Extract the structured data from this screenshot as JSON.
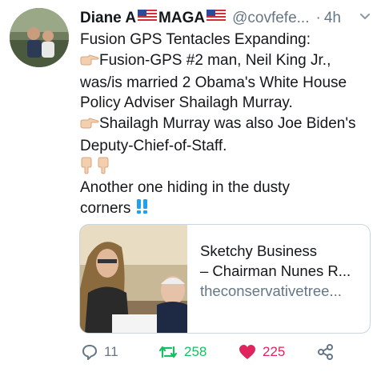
{
  "tweet": {
    "display_name": "Diane A",
    "name_suffix": "MAGA",
    "handle": "@covfefe...",
    "separator": "·",
    "time": "4h",
    "lines": [
      "Fusion GPS Tentacles Expanding:",
      "Fusion-GPS #2 man, Neil King Jr.,",
      "was/is married 2 Obama's White House",
      "Policy Adviser Shailagh Murray.",
      "Shailagh Murray was also Joe Biden's",
      "Deputy-Chief-of-Staff.",
      "Another one hiding in the dusty",
      "corners"
    ]
  },
  "card": {
    "title_line1": "Sketchy Business",
    "title_line2": "– Chairman Nunes R...",
    "domain": "theconservativetree..."
  },
  "actions": {
    "reply_count": "11",
    "retweet_count": "258",
    "like_count": "225"
  },
  "colors": {
    "text": "#14171a",
    "secondary": "#657786",
    "retweet": "#17bf63",
    "like": "#e0245e",
    "exclaim": "#1da1f2"
  },
  "icons": [
    "us-flag-icon",
    "chevron-down-icon",
    "pointing-right-icon",
    "pointing-down-icon",
    "double-exclamation-icon",
    "reply-icon",
    "retweet-icon",
    "heart-icon",
    "share-icon"
  ]
}
